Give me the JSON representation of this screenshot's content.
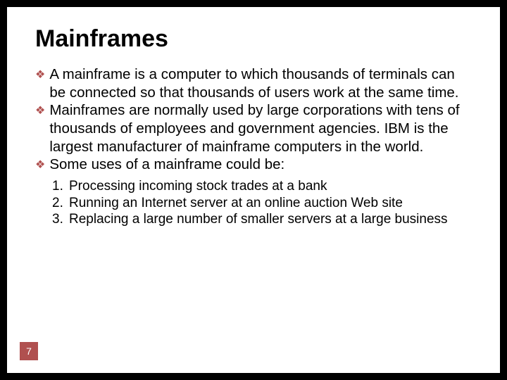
{
  "title": "Mainframes",
  "bullets": [
    "A mainframe is a computer to which thousands of terminals can be connected so that thousands of users work at the same time.",
    "Mainframes are normally used by large corporations with tens of thousands of employees and government agencies. IBM is the largest manufacturer of mainframe computers in the world.",
    "Some uses of a mainframe could be:"
  ],
  "numbered": [
    "Processing incoming stock trades at a bank",
    "Running an Internet server at an online auction Web site",
    "Replacing a large number of smaller servers at a large business"
  ],
  "numbers": [
    "1.",
    "2.",
    "3."
  ],
  "page": "7",
  "bullet_glyph": "❖"
}
